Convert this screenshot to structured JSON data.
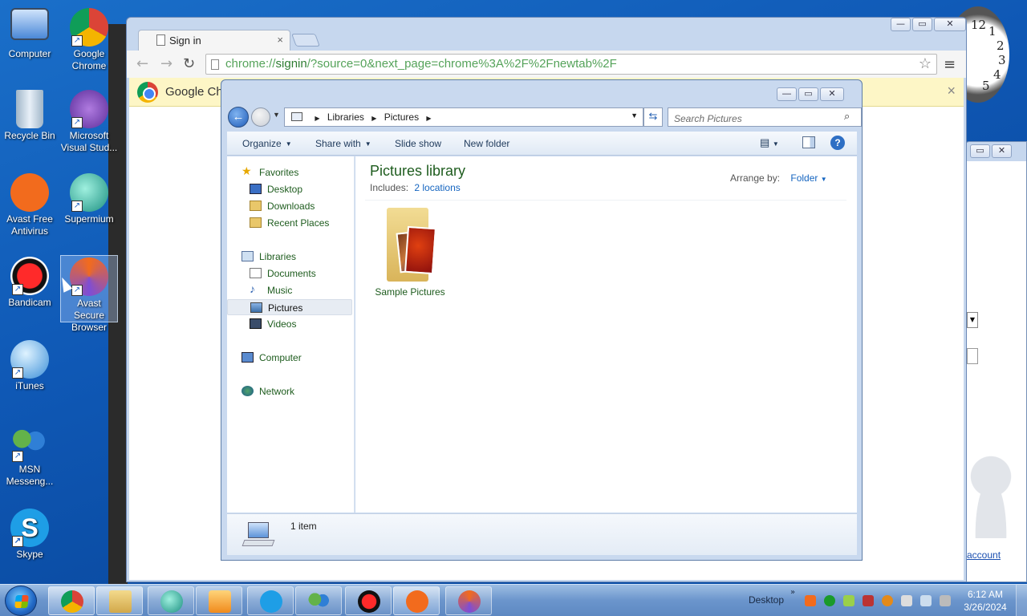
{
  "desktop": {
    "icons": [
      {
        "label": "Computer"
      },
      {
        "label": "Google Chrome"
      },
      {
        "label": "Recycle Bin"
      },
      {
        "label": "Microsoft Visual Stud..."
      },
      {
        "label": "Avast Free Antivirus"
      },
      {
        "label": "Supermium"
      },
      {
        "label": "Bandicam"
      },
      {
        "label": "Avast Secure Browser"
      },
      {
        "label": "iTunes"
      },
      {
        "label": "MSN Messeng..."
      },
      {
        "label": "Skype"
      }
    ],
    "clock_numbers": [
      "12",
      "1",
      "2",
      "3",
      "4",
      "5"
    ]
  },
  "chrome": {
    "tab_title": "Sign in",
    "tab_close": "×",
    "url_scheme": "chrome://",
    "url_host": "signin",
    "url_rest": "/?source=0&next_page=chrome%3A%2F%2Fnewtab%2F",
    "infobar_text": "Google Ch",
    "infobar_close": "×",
    "window_buttons": {
      "minimize": "—",
      "maximize": "▭",
      "close": "✕"
    }
  },
  "explorer": {
    "window_buttons": {
      "minimize": "—",
      "maximize": "▭",
      "close": "✕"
    },
    "breadcrumb": [
      "Libraries",
      "Pictures"
    ],
    "search_placeholder": "Search Pictures",
    "commands": [
      {
        "label": "Organize",
        "has_menu": true
      },
      {
        "label": "Share with",
        "has_menu": true
      },
      {
        "label": "Slide show",
        "has_menu": false
      },
      {
        "label": "New folder",
        "has_menu": false
      }
    ],
    "nav": {
      "favorites": "Favorites",
      "desktop": "Desktop",
      "downloads": "Downloads",
      "recent": "Recent Places",
      "libraries": "Libraries",
      "documents": "Documents",
      "music": "Music",
      "pictures": "Pictures",
      "videos": "Videos",
      "computer": "Computer",
      "network": "Network"
    },
    "library_title": "Pictures library",
    "includes_label": "Includes:",
    "includes_link": "2 locations",
    "arrange_label": "Arrange by:",
    "arrange_value": "Folder",
    "items": [
      {
        "name": "Sample Pictures"
      }
    ],
    "status": "1 item"
  },
  "right_window": {
    "link_text": "account"
  },
  "taskbar": {
    "tray_label": "Desktop",
    "time": "6:12 AM",
    "date": "3/26/2024"
  }
}
